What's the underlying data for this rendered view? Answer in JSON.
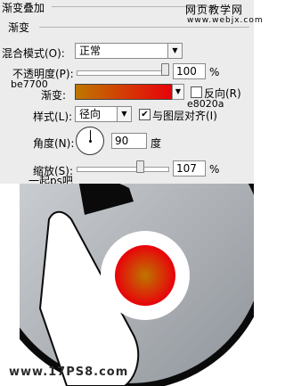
{
  "watermark_top": {
    "line1": "网页教学网",
    "line2": "www.webjx.com"
  },
  "panel": {
    "group_title": "渐变叠加",
    "sub_title": "渐变",
    "blend_mode": {
      "label": "混合模式(O):",
      "value": "正常"
    },
    "opacity": {
      "label": "不透明度(P):",
      "value": "100",
      "unit": "%",
      "level": 1.0
    },
    "gradient": {
      "label": "渐变:",
      "color_start_note": "be7700",
      "color_end_note": "e8020a",
      "start_color": "#be7700",
      "end_color": "#e8020a",
      "reverse_label": "反向(R)",
      "reverse_checked": false
    },
    "style": {
      "label": "样式(L):",
      "value": "径向",
      "align_label": "与图层对齐(I)",
      "align_checked": true
    },
    "angle": {
      "label": "角度(N):",
      "value": "90",
      "unit": "度",
      "degrees": 90
    },
    "scale": {
      "label": "缩放(S):",
      "value": "107",
      "unit": "%",
      "level": 0.71
    }
  },
  "caption": "一起ps吧",
  "watermark_bottom": "www.17PS8.com",
  "icons": {
    "dropdown": "chevron-down-icon",
    "check": "checkmark-icon"
  }
}
